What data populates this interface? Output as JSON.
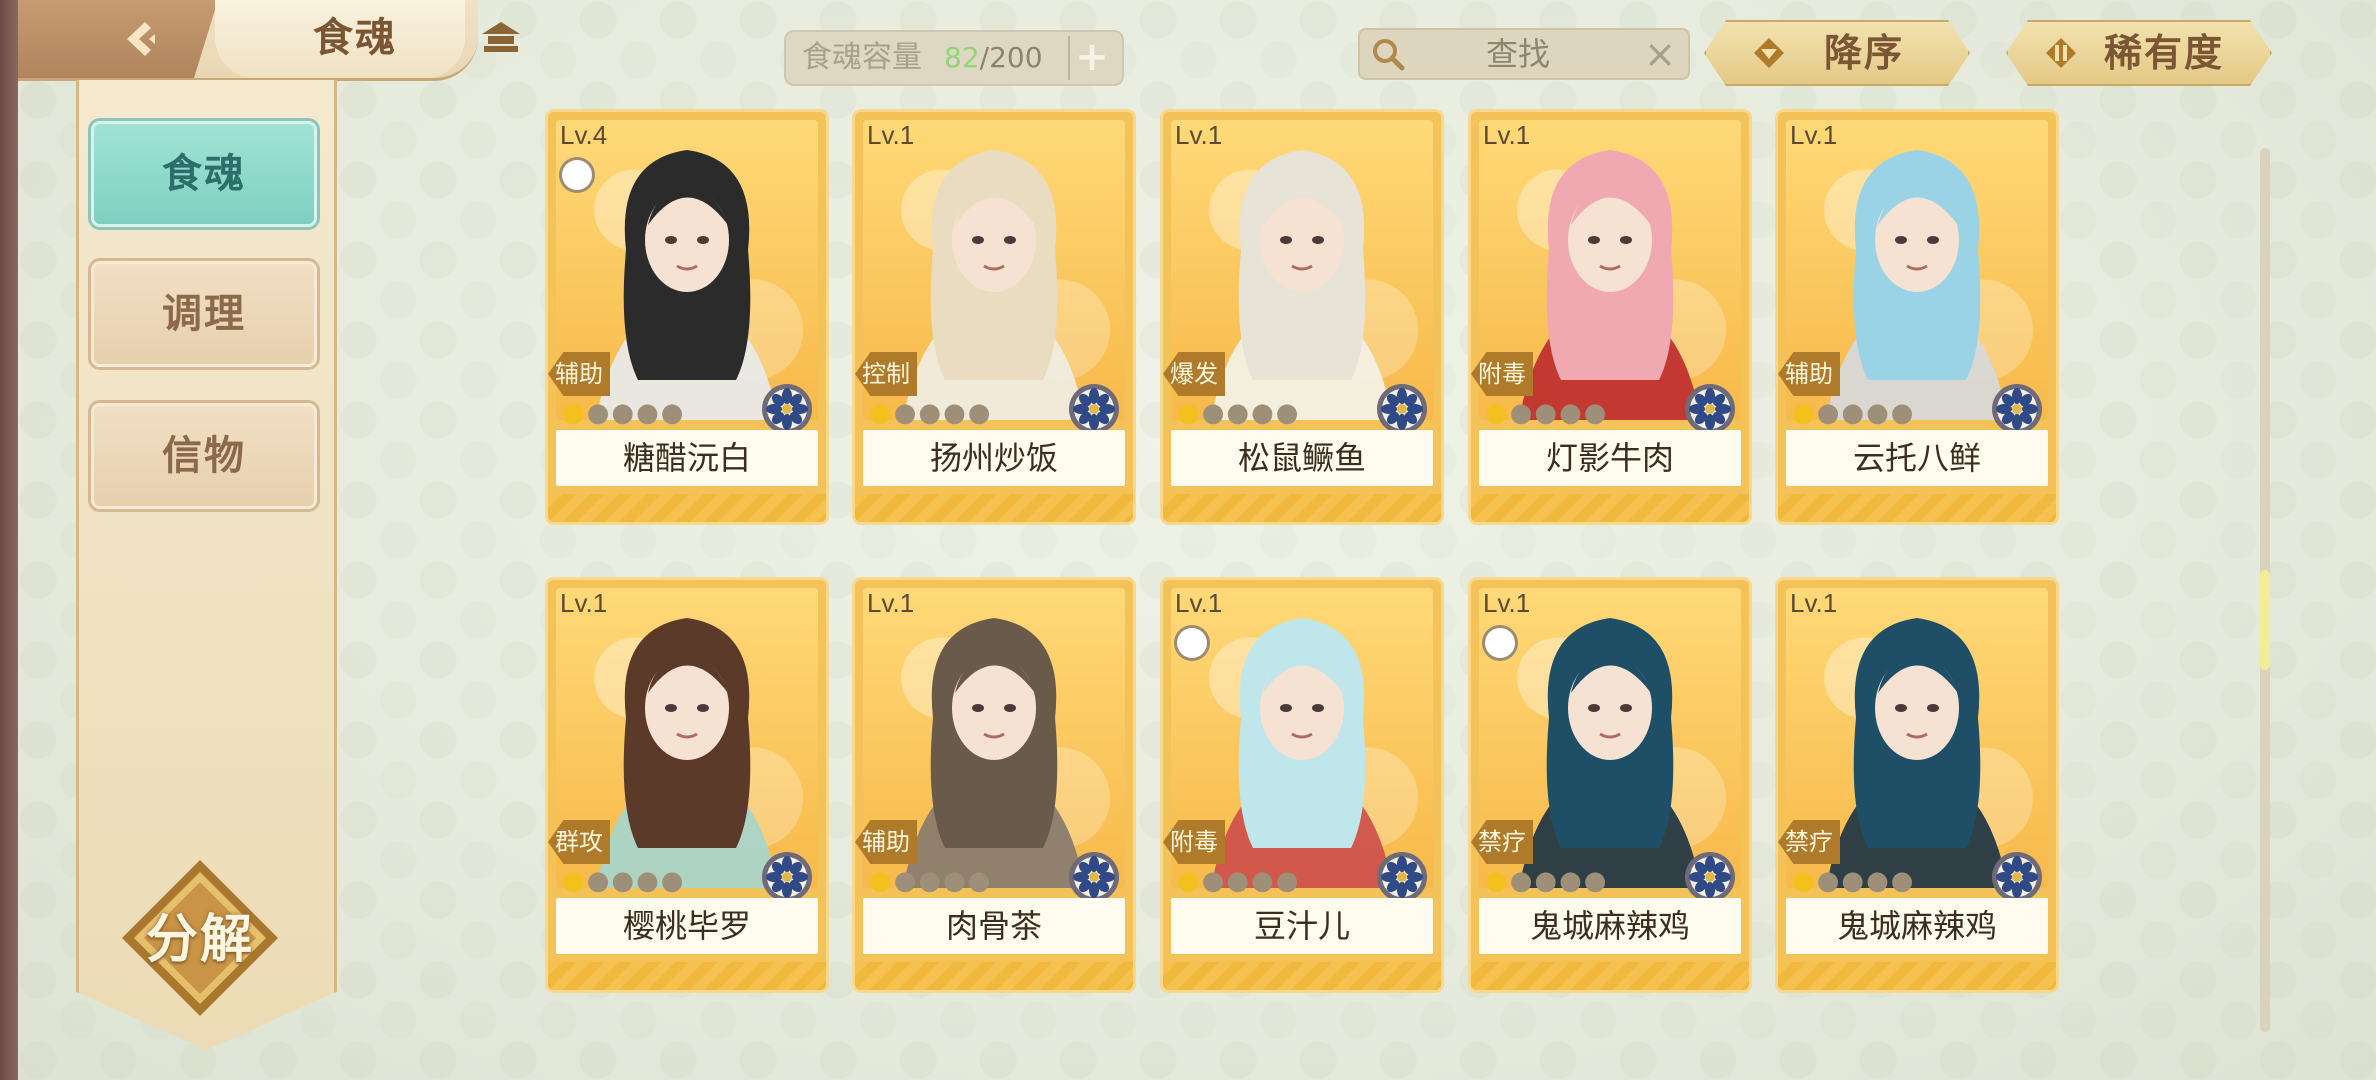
{
  "header": {
    "title": "食魂",
    "back_icon": "back-arrow-icon",
    "home_icon": "house-icon"
  },
  "capacity": {
    "label": "食魂容量",
    "current": "82",
    "separator": "/",
    "max": "200",
    "plus": "+"
  },
  "search": {
    "placeholder": "查找",
    "clear": "×"
  },
  "sort": {
    "order_label": "降序",
    "rarity_label": "稀有度"
  },
  "sidebar": {
    "items": [
      {
        "label": "食魂",
        "active": true
      },
      {
        "label": "调理",
        "active": false
      },
      {
        "label": "信物",
        "active": false
      }
    ],
    "decompose_label": "分解"
  },
  "cards": [
    {
      "level": "Lv.4",
      "role": "辅助",
      "name": "糖醋沅白",
      "stars_on": 1,
      "stars_total": 5,
      "badge": true,
      "hair": "#2b2b2b",
      "outfit": "#e9e9e9"
    },
    {
      "level": "Lv.1",
      "role": "控制",
      "name": "扬州炒饭",
      "stars_on": 1,
      "stars_total": 5,
      "badge": false,
      "hair": "#e9dcc1",
      "outfit": "#f0ece0"
    },
    {
      "level": "Lv.1",
      "role": "爆发",
      "name": "松鼠鳜鱼",
      "stars_on": 1,
      "stars_total": 5,
      "badge": false,
      "hair": "#e7e3d6",
      "outfit": "#f3f0e4"
    },
    {
      "level": "Lv.1",
      "role": "附毒",
      "name": "灯影牛肉",
      "stars_on": 1,
      "stars_total": 5,
      "badge": false,
      "hair": "#f0a9b0",
      "outfit": "#c0302e"
    },
    {
      "level": "Lv.1",
      "role": "辅助",
      "name": "云托八鲜",
      "stars_on": 1,
      "stars_total": 5,
      "badge": false,
      "hair": "#9ad3e6",
      "outfit": "#d8d8d8"
    },
    {
      "level": "Lv.1",
      "role": "群攻",
      "name": "樱桃毕罗",
      "stars_on": 1,
      "stars_total": 5,
      "badge": false,
      "hair": "#5b3a2a",
      "outfit": "#a9d4c8"
    },
    {
      "level": "Lv.1",
      "role": "辅助",
      "name": "肉骨茶",
      "stars_on": 1,
      "stars_total": 5,
      "badge": false,
      "hair": "#6a5a4a",
      "outfit": "#8a7c6e"
    },
    {
      "level": "Lv.1",
      "role": "附毒",
      "name": "豆汁儿",
      "stars_on": 1,
      "stars_total": 5,
      "badge": true,
      "hair": "#bfe6ea",
      "outfit": "#d0524c"
    },
    {
      "level": "Lv.1",
      "role": "禁疗",
      "name": "鬼城麻辣鸡",
      "stars_on": 1,
      "stars_total": 5,
      "badge": true,
      "hair": "#1f4f66",
      "outfit": "#243845"
    },
    {
      "level": "Lv.1",
      "role": "禁疗",
      "name": "鬼城麻辣鸡",
      "stars_on": 1,
      "stars_total": 5,
      "badge": false,
      "hair": "#1f4f66",
      "outfit": "#243845"
    }
  ],
  "colors": {
    "accent_teal": "#8fdacb",
    "card_gold": "#f3c35a",
    "capacity_current": "#92d478"
  }
}
